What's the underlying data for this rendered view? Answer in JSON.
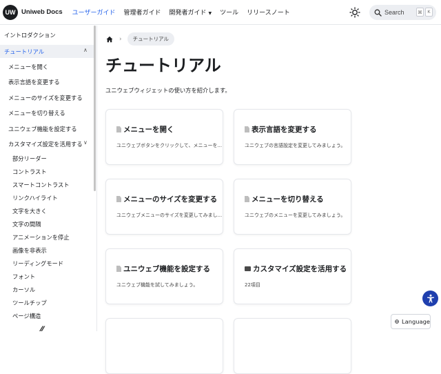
{
  "header": {
    "logo_text": "UW",
    "brand": "Uniweb Docs",
    "nav": [
      "ユーザーガイド",
      "管理者ガイド",
      "開発者ガイド",
      "ツール",
      "リリースノート"
    ],
    "search_label": "Search",
    "search_keys": [
      "⌘",
      "K"
    ]
  },
  "sidebar": {
    "items": [
      {
        "label": "イントロダクション"
      },
      {
        "label": "チュートリアル"
      },
      {
        "label": "メニューを開く"
      },
      {
        "label": "表示言語を変更する"
      },
      {
        "label": "メニューのサイズを変更する"
      },
      {
        "label": "メニューを切り替える"
      },
      {
        "label": "ユニウェブ機能を設定する"
      },
      {
        "label": "カスタマイズ設定を活用する"
      },
      {
        "label": "部分リーダー"
      },
      {
        "label": "コントラスト"
      },
      {
        "label": "スマートコントラスト"
      },
      {
        "label": "リンクハイライト"
      },
      {
        "label": "文字を大きく"
      },
      {
        "label": "文字の間隔"
      },
      {
        "label": "アニメーションを停止"
      },
      {
        "label": "画像を非表示"
      },
      {
        "label": "リーディングモード"
      },
      {
        "label": "フォント"
      },
      {
        "label": "カーソル"
      },
      {
        "label": "ツールチップ"
      },
      {
        "label": "ページ構造"
      }
    ]
  },
  "main": {
    "breadcrumb": "チュートリアル",
    "title": "チュートリアル",
    "subtitle": "ユニウェブウィジェットの使い方を紹介します。",
    "cards": [
      {
        "title": "メニューを開く",
        "desc": "ユニウェブボタンをクリックして、メニューを...",
        "icon": "doc"
      },
      {
        "title": "表示言語を変更する",
        "desc": "ユニウェブの言語設定を変更してみましょう。",
        "icon": "doc"
      },
      {
        "title": "メニューのサイズを変更する",
        "desc": "ユニウェブメニューのサイズを変更してみまし...",
        "icon": "doc"
      },
      {
        "title": "メニューを切り替える",
        "desc": "ユニウェブのメニューを変更してみましょう。",
        "icon": "doc"
      },
      {
        "title": "ユニウェブ機能を設定する",
        "desc": "ユニウェブ機能を試してみましょう。",
        "icon": "doc"
      },
      {
        "title": "カスタマイズ設定を活用する",
        "desc": "22項目",
        "icon": "folder"
      }
    ]
  },
  "language_button": "Language",
  "colors": {
    "accent": "#2563eb",
    "a11y_button": "#1f3fae"
  }
}
